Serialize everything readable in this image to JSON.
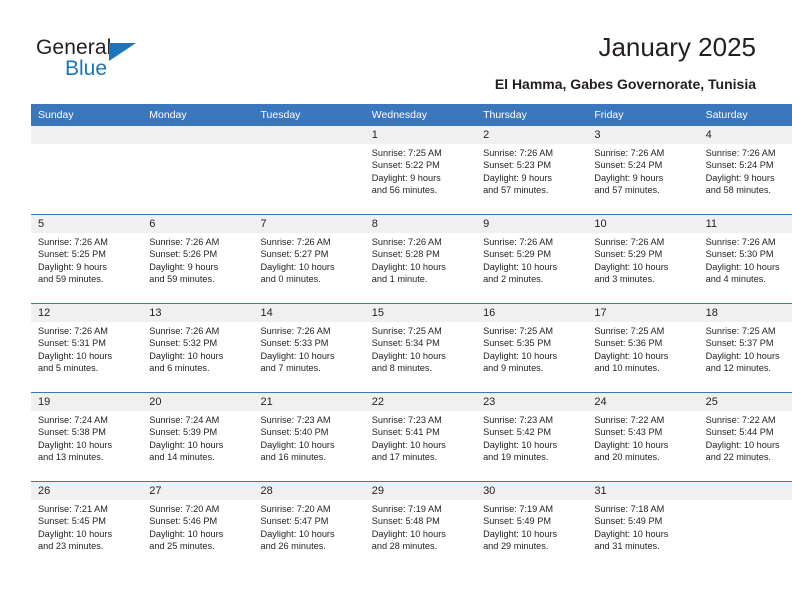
{
  "brand": {
    "name_dark": "General",
    "name_blue": "Blue",
    "accent_color": "#1c75bc"
  },
  "header": {
    "title": "January 2025",
    "subtitle": "El Hamma, Gabes Governorate, Tunisia"
  },
  "calendar": {
    "header_bg": "#3b77bc",
    "daynum_bg": "#f0f0f0",
    "weekday_headers": [
      "Sunday",
      "Monday",
      "Tuesday",
      "Wednesday",
      "Thursday",
      "Friday",
      "Saturday"
    ],
    "weeks": [
      [
        {
          "day": "",
          "lines": []
        },
        {
          "day": "",
          "lines": []
        },
        {
          "day": "",
          "lines": []
        },
        {
          "day": "1",
          "lines": [
            "Sunrise: 7:25 AM",
            "Sunset: 5:22 PM",
            "Daylight: 9 hours",
            "and 56 minutes."
          ]
        },
        {
          "day": "2",
          "lines": [
            "Sunrise: 7:26 AM",
            "Sunset: 5:23 PM",
            "Daylight: 9 hours",
            "and 57 minutes."
          ]
        },
        {
          "day": "3",
          "lines": [
            "Sunrise: 7:26 AM",
            "Sunset: 5:24 PM",
            "Daylight: 9 hours",
            "and 57 minutes."
          ]
        },
        {
          "day": "4",
          "lines": [
            "Sunrise: 7:26 AM",
            "Sunset: 5:24 PM",
            "Daylight: 9 hours",
            "and 58 minutes."
          ]
        }
      ],
      [
        {
          "day": "5",
          "lines": [
            "Sunrise: 7:26 AM",
            "Sunset: 5:25 PM",
            "Daylight: 9 hours",
            "and 59 minutes."
          ]
        },
        {
          "day": "6",
          "lines": [
            "Sunrise: 7:26 AM",
            "Sunset: 5:26 PM",
            "Daylight: 9 hours",
            "and 59 minutes."
          ]
        },
        {
          "day": "7",
          "lines": [
            "Sunrise: 7:26 AM",
            "Sunset: 5:27 PM",
            "Daylight: 10 hours",
            "and 0 minutes."
          ]
        },
        {
          "day": "8",
          "lines": [
            "Sunrise: 7:26 AM",
            "Sunset: 5:28 PM",
            "Daylight: 10 hours",
            "and 1 minute."
          ]
        },
        {
          "day": "9",
          "lines": [
            "Sunrise: 7:26 AM",
            "Sunset: 5:29 PM",
            "Daylight: 10 hours",
            "and 2 minutes."
          ]
        },
        {
          "day": "10",
          "lines": [
            "Sunrise: 7:26 AM",
            "Sunset: 5:29 PM",
            "Daylight: 10 hours",
            "and 3 minutes."
          ]
        },
        {
          "day": "11",
          "lines": [
            "Sunrise: 7:26 AM",
            "Sunset: 5:30 PM",
            "Daylight: 10 hours",
            "and 4 minutes."
          ]
        }
      ],
      [
        {
          "day": "12",
          "lines": [
            "Sunrise: 7:26 AM",
            "Sunset: 5:31 PM",
            "Daylight: 10 hours",
            "and 5 minutes."
          ]
        },
        {
          "day": "13",
          "lines": [
            "Sunrise: 7:26 AM",
            "Sunset: 5:32 PM",
            "Daylight: 10 hours",
            "and 6 minutes."
          ]
        },
        {
          "day": "14",
          "lines": [
            "Sunrise: 7:26 AM",
            "Sunset: 5:33 PM",
            "Daylight: 10 hours",
            "and 7 minutes."
          ]
        },
        {
          "day": "15",
          "lines": [
            "Sunrise: 7:25 AM",
            "Sunset: 5:34 PM",
            "Daylight: 10 hours",
            "and 8 minutes."
          ]
        },
        {
          "day": "16",
          "lines": [
            "Sunrise: 7:25 AM",
            "Sunset: 5:35 PM",
            "Daylight: 10 hours",
            "and 9 minutes."
          ]
        },
        {
          "day": "17",
          "lines": [
            "Sunrise: 7:25 AM",
            "Sunset: 5:36 PM",
            "Daylight: 10 hours",
            "and 10 minutes."
          ]
        },
        {
          "day": "18",
          "lines": [
            "Sunrise: 7:25 AM",
            "Sunset: 5:37 PM",
            "Daylight: 10 hours",
            "and 12 minutes."
          ]
        }
      ],
      [
        {
          "day": "19",
          "lines": [
            "Sunrise: 7:24 AM",
            "Sunset: 5:38 PM",
            "Daylight: 10 hours",
            "and 13 minutes."
          ]
        },
        {
          "day": "20",
          "lines": [
            "Sunrise: 7:24 AM",
            "Sunset: 5:39 PM",
            "Daylight: 10 hours",
            "and 14 minutes."
          ]
        },
        {
          "day": "21",
          "lines": [
            "Sunrise: 7:23 AM",
            "Sunset: 5:40 PM",
            "Daylight: 10 hours",
            "and 16 minutes."
          ]
        },
        {
          "day": "22",
          "lines": [
            "Sunrise: 7:23 AM",
            "Sunset: 5:41 PM",
            "Daylight: 10 hours",
            "and 17 minutes."
          ]
        },
        {
          "day": "23",
          "lines": [
            "Sunrise: 7:23 AM",
            "Sunset: 5:42 PM",
            "Daylight: 10 hours",
            "and 19 minutes."
          ]
        },
        {
          "day": "24",
          "lines": [
            "Sunrise: 7:22 AM",
            "Sunset: 5:43 PM",
            "Daylight: 10 hours",
            "and 20 minutes."
          ]
        },
        {
          "day": "25",
          "lines": [
            "Sunrise: 7:22 AM",
            "Sunset: 5:44 PM",
            "Daylight: 10 hours",
            "and 22 minutes."
          ]
        }
      ],
      [
        {
          "day": "26",
          "lines": [
            "Sunrise: 7:21 AM",
            "Sunset: 5:45 PM",
            "Daylight: 10 hours",
            "and 23 minutes."
          ]
        },
        {
          "day": "27",
          "lines": [
            "Sunrise: 7:20 AM",
            "Sunset: 5:46 PM",
            "Daylight: 10 hours",
            "and 25 minutes."
          ]
        },
        {
          "day": "28",
          "lines": [
            "Sunrise: 7:20 AM",
            "Sunset: 5:47 PM",
            "Daylight: 10 hours",
            "and 26 minutes."
          ]
        },
        {
          "day": "29",
          "lines": [
            "Sunrise: 7:19 AM",
            "Sunset: 5:48 PM",
            "Daylight: 10 hours",
            "and 28 minutes."
          ]
        },
        {
          "day": "30",
          "lines": [
            "Sunrise: 7:19 AM",
            "Sunset: 5:49 PM",
            "Daylight: 10 hours",
            "and 29 minutes."
          ]
        },
        {
          "day": "31",
          "lines": [
            "Sunrise: 7:18 AM",
            "Sunset: 5:49 PM",
            "Daylight: 10 hours",
            "and 31 minutes."
          ]
        },
        {
          "day": "",
          "lines": []
        }
      ]
    ]
  }
}
